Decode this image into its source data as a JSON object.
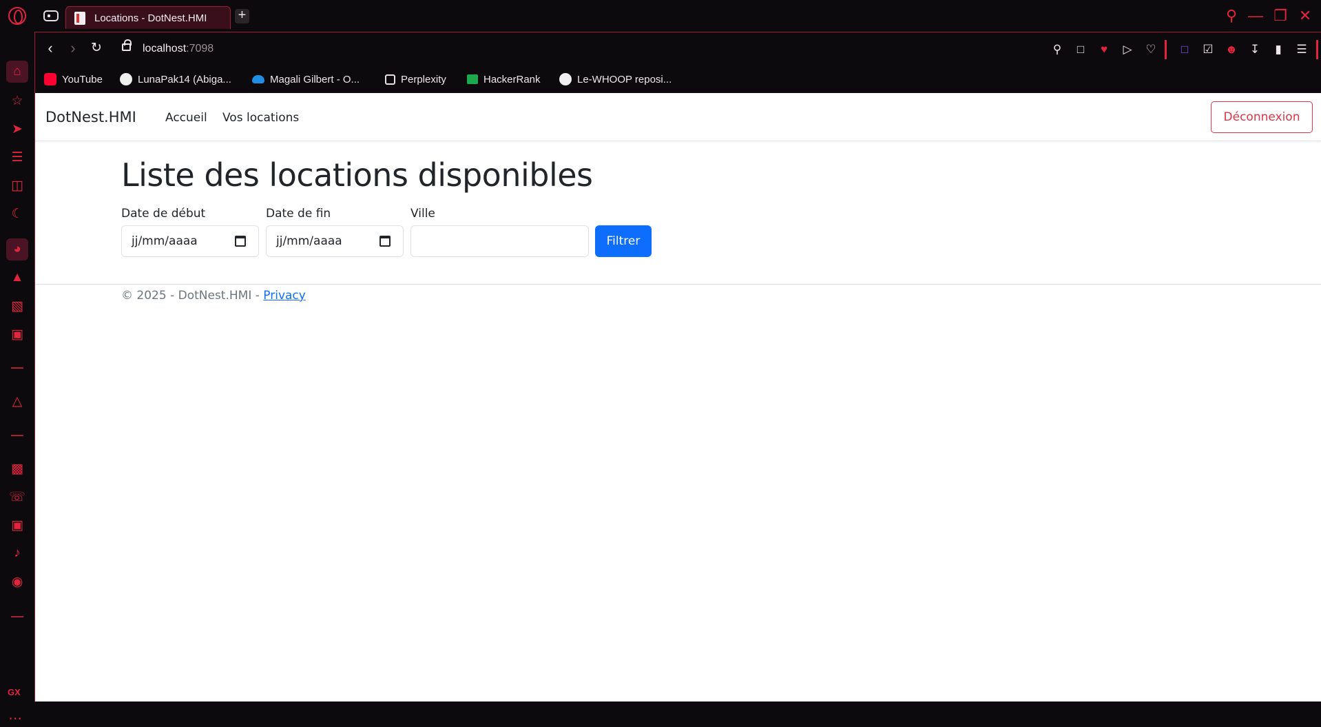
{
  "browser": {
    "tab": {
      "title": "Locations - DotNest.HMI"
    },
    "address": {
      "host": "localhost",
      "port": ":7098"
    },
    "bookmarks": [
      {
        "label": "YouTube",
        "icon": "youtube-icon"
      },
      {
        "label": "LunaPak14 (Abiga...",
        "icon": "github-icon"
      },
      {
        "label": "Magali Gilbert - O...",
        "icon": "onedrive-icon"
      },
      {
        "label": "Perplexity",
        "icon": "perplexity-icon"
      },
      {
        "label": "HackerRank",
        "icon": "hackerrank-icon"
      },
      {
        "label": "Le-WHOOP reposi...",
        "icon": "github-icon"
      }
    ],
    "sidebar_gx": "GX",
    "accent_color": "#e2243f"
  },
  "app": {
    "brand": "DotNest.HMI",
    "nav": {
      "home": "Accueil",
      "rentals": "Vos locations"
    },
    "logout": "Déconnexion",
    "heading": "Liste des locations disponibles",
    "filters": {
      "start_label": "Date de début",
      "start_value": "jj/mm/aaaa",
      "end_label": "Date de fin",
      "end_value": "jj/mm/aaaa",
      "city_label": "Ville",
      "city_value": "",
      "submit": "Filtrer"
    },
    "footer": {
      "text": "© 2025 - DotNest.HMI - ",
      "link": "Privacy"
    },
    "primary_color": "#0d6efd",
    "danger_color": "#dc3545"
  }
}
